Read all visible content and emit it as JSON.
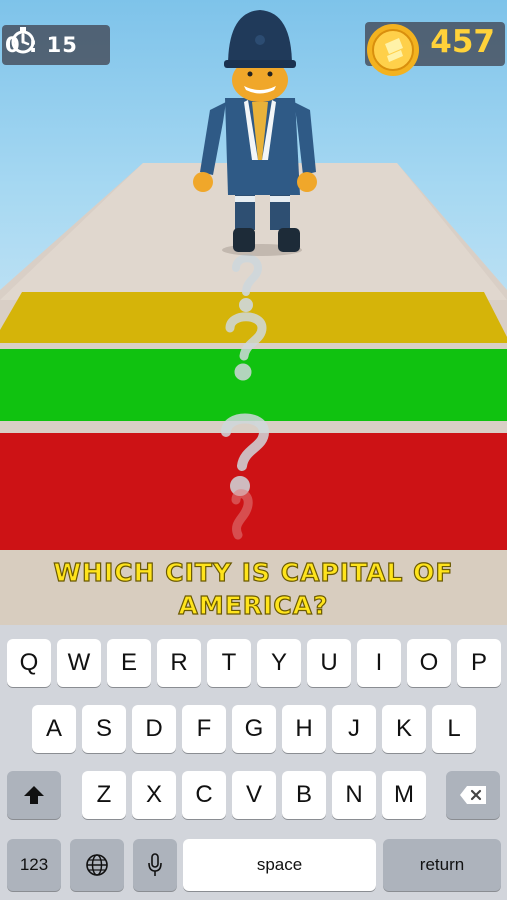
{
  "hud": {
    "timer": "0 : 15",
    "timer_icon": "stopwatch-icon",
    "coins": "457",
    "coin_icon": "coin-icon"
  },
  "lanes": {
    "colors": [
      "#d5b409",
      "#10c210",
      "#cd1215"
    ],
    "track_color": "#d9cfc6",
    "marker_icon": "question-mark-icon"
  },
  "question": {
    "line1": "WHICH CITY IS CAPITAL OF",
    "line2": "AMERICA?"
  },
  "keyboard": {
    "row1": [
      "Q",
      "W",
      "E",
      "R",
      "T",
      "Y",
      "U",
      "I",
      "O",
      "P"
    ],
    "row2": [
      "A",
      "S",
      "D",
      "F",
      "G",
      "H",
      "J",
      "K",
      "L"
    ],
    "row3": [
      "Z",
      "X",
      "C",
      "V",
      "B",
      "N",
      "M"
    ],
    "shift_icon": "shift-icon",
    "backspace_icon": "backspace-icon",
    "numbers": "123",
    "globe_icon": "globe-icon",
    "mic_icon": "microphone-icon",
    "space": "space",
    "return": "return"
  }
}
